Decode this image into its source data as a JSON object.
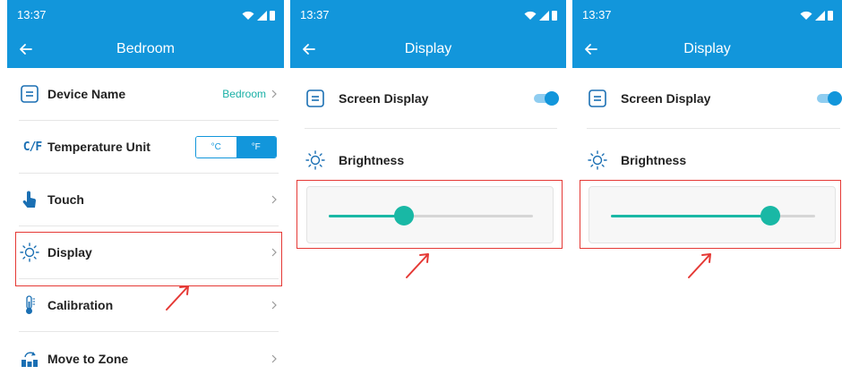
{
  "colors": {
    "header": "#1296db",
    "accent_teal": "#19b8a5",
    "annotation_red": "#e53935"
  },
  "status_bar": {
    "time": "13:37",
    "icons": [
      "wifi-icon",
      "signal-icon",
      "battery-icon"
    ]
  },
  "screen1": {
    "title": "Bedroom",
    "items": [
      {
        "label": "Device Name",
        "value": "Bedroom",
        "icon": "device-name-icon"
      },
      {
        "label": "Temperature Unit",
        "icon": "cf-icon",
        "icon_text": "C/F",
        "options": [
          "°C",
          "°F"
        ],
        "selected": "°F"
      },
      {
        "label": "Touch",
        "icon": "touch-icon"
      },
      {
        "label": "Display",
        "icon": "brightness-icon"
      },
      {
        "label": "Calibration",
        "icon": "thermometer-icon"
      },
      {
        "label": "Move to Zone",
        "icon": "zone-icon"
      }
    ]
  },
  "screen2": {
    "title": "Display",
    "screen_display_label": "Screen Display",
    "screen_display_on": true,
    "brightness_label": "Brightness",
    "brightness_fraction": 0.37
  },
  "screen3": {
    "title": "Display",
    "screen_display_label": "Screen Display",
    "screen_display_on": true,
    "brightness_label": "Brightness",
    "brightness_fraction": 0.78
  }
}
